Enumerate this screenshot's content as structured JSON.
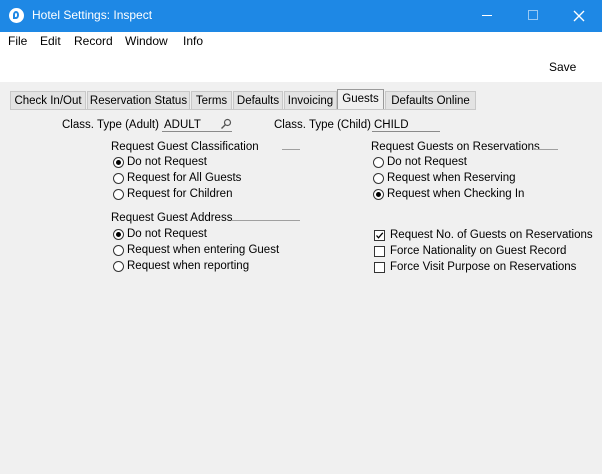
{
  "window": {
    "title": "Hotel Settings: Inspect"
  },
  "menu": [
    "File",
    "Edit",
    "Record",
    "Window",
    "Info"
  ],
  "toolbar": {
    "save_label": "Save"
  },
  "tabs": [
    {
      "label": "Check In/Out",
      "active": false
    },
    {
      "label": "Reservation Status",
      "active": false
    },
    {
      "label": "Terms",
      "active": false
    },
    {
      "label": "Defaults",
      "active": false
    },
    {
      "label": "Invoicing",
      "active": false
    },
    {
      "label": "Guests",
      "active": true
    },
    {
      "label": "Defaults Online",
      "active": false
    }
  ],
  "fields": {
    "class_type_adult": {
      "label": "Class. Type (Adult)",
      "value": "ADULT"
    },
    "class_type_child": {
      "label": "Class. Type (Child)",
      "value": "CHILD"
    }
  },
  "groups": {
    "guest_classification": {
      "title": "Request Guest Classification",
      "options": [
        {
          "label": "Do not Request",
          "selected": true
        },
        {
          "label": "Request for All Guests",
          "selected": false
        },
        {
          "label": "Request for Children",
          "selected": false
        }
      ]
    },
    "guests_on_reservations": {
      "title": "Request Guests on Reservations",
      "options": [
        {
          "label": "Do not Request",
          "selected": false
        },
        {
          "label": "Request when Reserving",
          "selected": false
        },
        {
          "label": "Request when Checking In",
          "selected": true
        }
      ]
    },
    "guest_address": {
      "title": "Request Guest Address",
      "options": [
        {
          "label": "Do not Request",
          "selected": true
        },
        {
          "label": "Request when entering Guest",
          "selected": false
        },
        {
          "label": "Request when reporting",
          "selected": false
        }
      ]
    }
  },
  "checkboxes": [
    {
      "label": "Request No. of Guests on Reservations",
      "checked": true
    },
    {
      "label": "Force Nationality on Guest Record",
      "checked": false
    },
    {
      "label": "Force Visit Purpose on Reservations",
      "checked": false
    }
  ],
  "colors": {
    "titlebar": "#1e88e5",
    "background": "#f0f0f0"
  }
}
